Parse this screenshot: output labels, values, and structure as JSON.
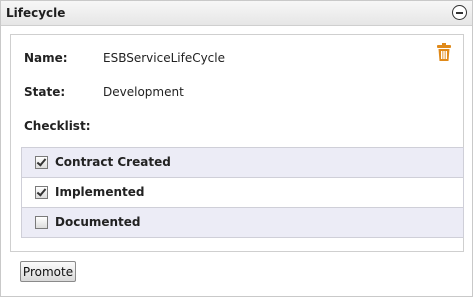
{
  "panel": {
    "title": "Lifecycle",
    "collapse_icon": "minus-circle-icon"
  },
  "fields": {
    "name_label": "Name:",
    "name_value": "ESBServiceLifeCycle",
    "state_label": "State:",
    "state_value": "Development",
    "checklist_label": "Checklist:"
  },
  "delete_icon": "trash-icon",
  "checklist": [
    {
      "label": "Contract Created",
      "checked": true
    },
    {
      "label": "Implemented",
      "checked": true
    },
    {
      "label": "Documented",
      "checked": false
    }
  ],
  "actions": {
    "promote_label": "Promote"
  },
  "colors": {
    "trash": "#e08a1a",
    "row_alt": "#ececf6"
  }
}
